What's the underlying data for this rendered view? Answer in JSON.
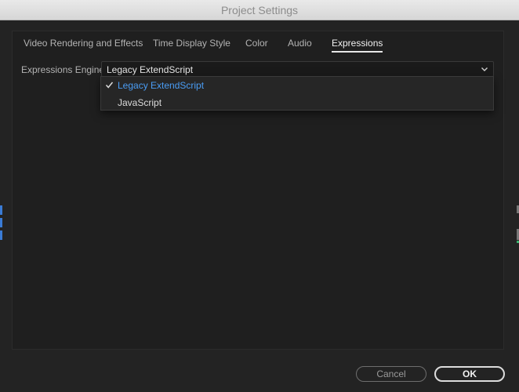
{
  "window": {
    "title": "Project Settings"
  },
  "tabs": [
    {
      "label": "Video Rendering and Effects",
      "active": false
    },
    {
      "label": "Time Display Style",
      "active": false
    },
    {
      "label": "Color",
      "active": false
    },
    {
      "label": "Audio",
      "active": false
    },
    {
      "label": "Expressions",
      "active": true
    }
  ],
  "expressions": {
    "engine_label": "Expressions Engine:",
    "selected_value": "Legacy ExtendScript",
    "options": [
      {
        "label": "Legacy ExtendScript",
        "checked": true
      },
      {
        "label": "JavaScript",
        "checked": false
      }
    ]
  },
  "buttons": {
    "cancel_label": "Cancel",
    "ok_label": "OK"
  },
  "colors": {
    "background": "#232323",
    "panel": "#1f1f1f",
    "selected_option": "#4a9df5",
    "titlebar": "#e0e0e0"
  }
}
